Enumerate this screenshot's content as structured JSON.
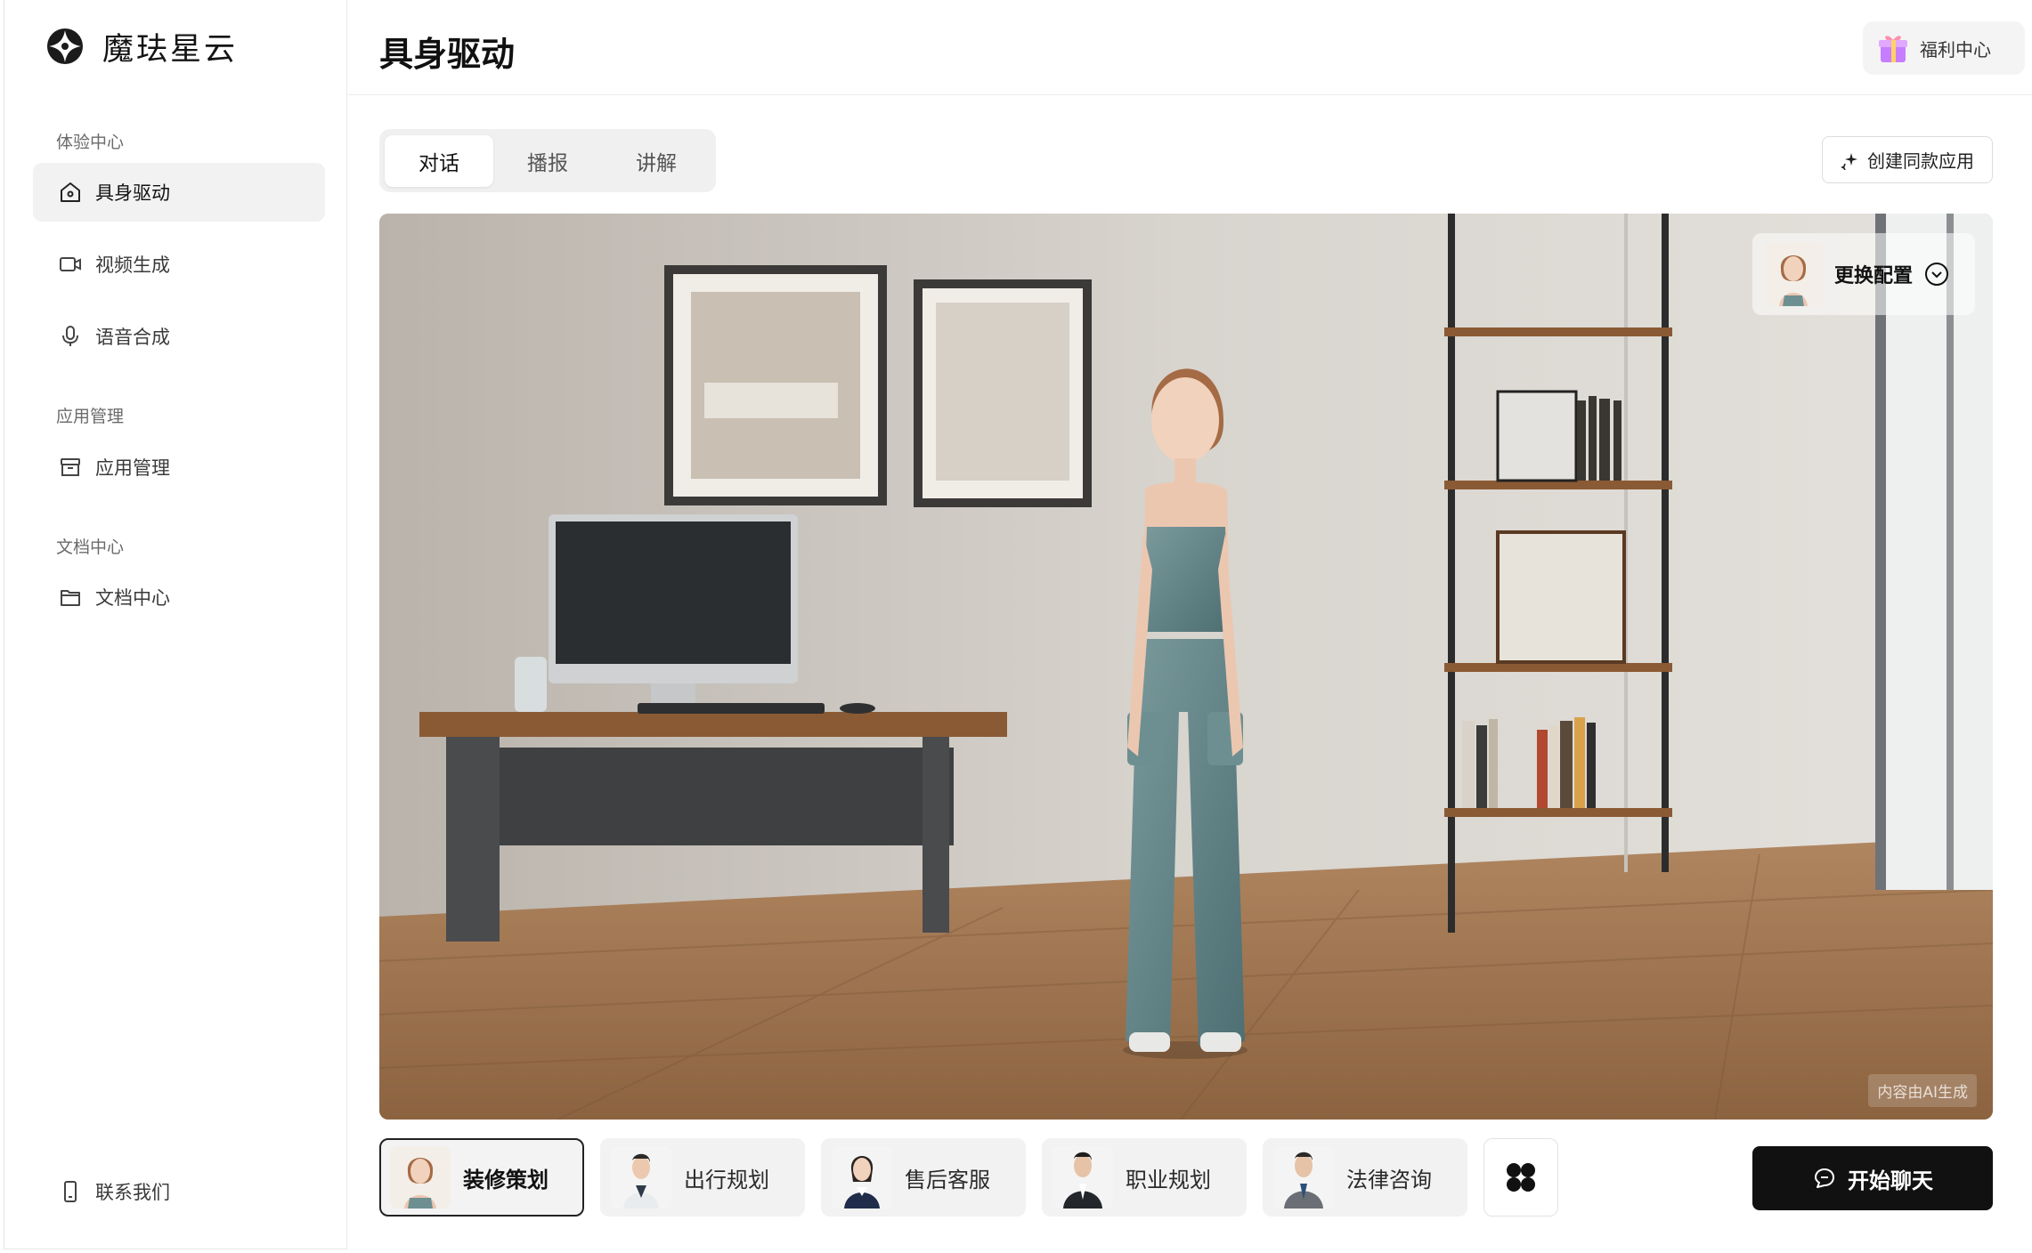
{
  "brand": {
    "name": "魔珐星云",
    "icon": "brand-logo-icon"
  },
  "sidebar": {
    "sections": [
      {
        "label": "体验中心"
      },
      {
        "label": "应用管理"
      },
      {
        "label": "文档中心"
      }
    ],
    "items": [
      {
        "label": "具身驱动",
        "icon": "home-icon",
        "active": true
      },
      {
        "label": "视频生成",
        "icon": "video-icon"
      },
      {
        "label": "语音合成",
        "icon": "microphone-icon"
      },
      {
        "label": "应用管理",
        "icon": "box-icon"
      },
      {
        "label": "文档中心",
        "icon": "folder-icon"
      }
    ],
    "footer": {
      "label": "联系我们",
      "icon": "phone-icon"
    }
  },
  "header": {
    "title": "具身驱动",
    "welfare_label": "福利中心"
  },
  "tabs": [
    {
      "label": "对话",
      "active": true
    },
    {
      "label": "播报"
    },
    {
      "label": "讲解"
    }
  ],
  "create_button": {
    "label": "创建同款应用"
  },
  "stage": {
    "config_label": "更换配置",
    "watermark": "内容由AI生成"
  },
  "scenarios": [
    {
      "label": "装修策划",
      "active": true
    },
    {
      "label": "出行规划"
    },
    {
      "label": "售后客服"
    },
    {
      "label": "职业规划"
    },
    {
      "label": "法律咨询"
    }
  ],
  "chat_button": {
    "label": "开始聊天"
  },
  "colors": {
    "accent": "#111111",
    "tab_bg": "#f0f0f0",
    "active_nav_bg": "#f2f2f2"
  }
}
